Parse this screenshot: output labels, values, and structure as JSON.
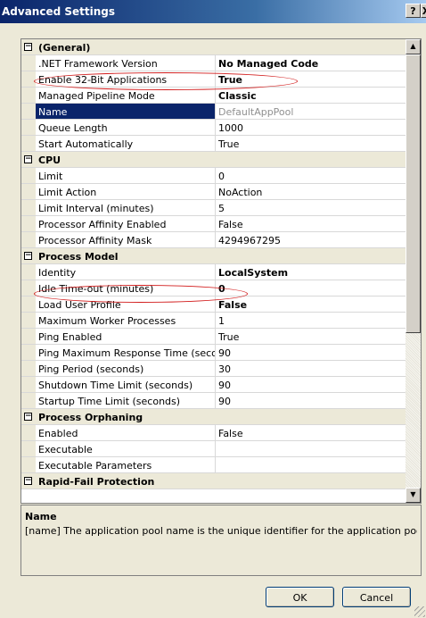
{
  "window": {
    "title": "Advanced Settings",
    "help_label": "?",
    "close_label": "X"
  },
  "grid": {
    "collapse_glyph": "−",
    "categories": [
      {
        "title": "(General)",
        "properties": [
          {
            "name": ".NET Framework Version",
            "value": "No Managed Code",
            "bold": true
          },
          {
            "name": "Enable 32-Bit Applications",
            "value": "True",
            "bold": true,
            "highlighted": true
          },
          {
            "name": "Managed Pipeline Mode",
            "value": "Classic",
            "bold": true
          },
          {
            "name": "Name",
            "value": "DefaultAppPool",
            "selected": true,
            "dim": true
          },
          {
            "name": "Queue Length",
            "value": "1000"
          },
          {
            "name": "Start Automatically",
            "value": "True"
          }
        ]
      },
      {
        "title": "CPU",
        "properties": [
          {
            "name": "Limit",
            "value": "0"
          },
          {
            "name": "Limit Action",
            "value": "NoAction"
          },
          {
            "name": "Limit Interval (minutes)",
            "value": "5"
          },
          {
            "name": "Processor Affinity Enabled",
            "value": "False"
          },
          {
            "name": "Processor Affinity Mask",
            "value": "4294967295"
          }
        ]
      },
      {
        "title": "Process Model",
        "properties": [
          {
            "name": "Identity",
            "value": "LocalSystem",
            "bold": true
          },
          {
            "name": "Idle Time-out (minutes)",
            "value": "0",
            "bold": true,
            "highlighted": true
          },
          {
            "name": "Load User Profile",
            "value": "False",
            "bold": true
          },
          {
            "name": "Maximum Worker Processes",
            "value": "1"
          },
          {
            "name": "Ping Enabled",
            "value": "True"
          },
          {
            "name": "Ping Maximum Response Time (seconds)",
            "value": "90"
          },
          {
            "name": "Ping Period (seconds)",
            "value": "30"
          },
          {
            "name": "Shutdown Time Limit (seconds)",
            "value": "90"
          },
          {
            "name": "Startup Time Limit (seconds)",
            "value": "90"
          }
        ]
      },
      {
        "title": "Process Orphaning",
        "properties": [
          {
            "name": "Enabled",
            "value": "False"
          },
          {
            "name": "Executable",
            "value": ""
          },
          {
            "name": "Executable Parameters",
            "value": ""
          }
        ]
      },
      {
        "title": "Rapid-Fail Protection",
        "properties": []
      }
    ]
  },
  "description": {
    "title": "Name",
    "text": "[name] The application pool name is the unique identifier for the application pool."
  },
  "buttons": {
    "ok_label": "OK",
    "cancel_label": "Cancel"
  },
  "colors": {
    "selection": "#0a246a",
    "annotation": "#d21c1c"
  }
}
